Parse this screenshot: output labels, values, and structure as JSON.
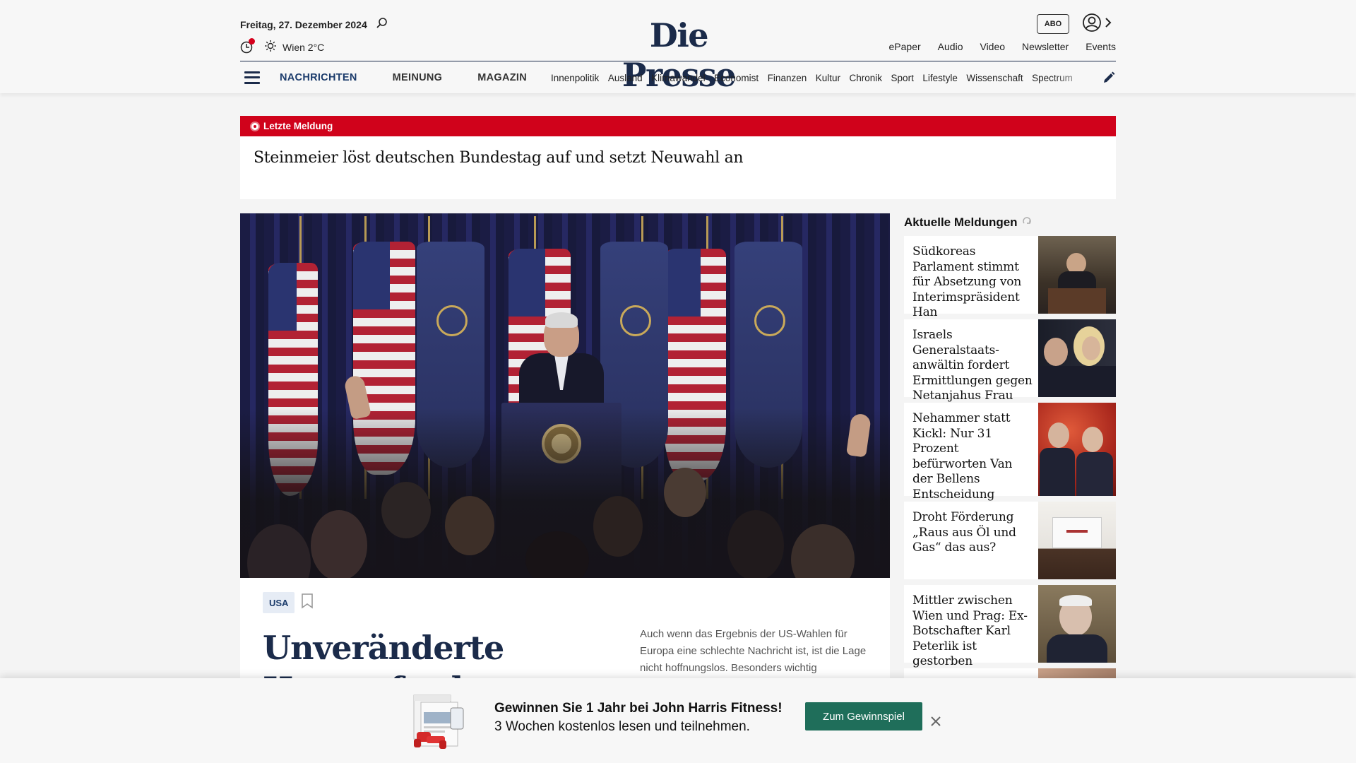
{
  "header": {
    "date": "Freitag, 27. Dezember 2024",
    "weather": "Wien 2°C",
    "logo": "Die Presse",
    "abo_label": "ABO",
    "top_links": [
      "ePaper",
      "Audio",
      "Video",
      "Newsletter",
      "Events"
    ],
    "main_nav": [
      "NACHRICHTEN",
      "MEINUNG",
      "MAGAZIN"
    ],
    "sub_nav": [
      "Innenpolitik",
      "Ausland",
      "Klimawandel",
      "Economist",
      "Finanzen",
      "Kultur",
      "Chronik",
      "Sport",
      "Lifestyle",
      "Wissenschaft",
      "Spectrum"
    ]
  },
  "breaking": {
    "label": "Letzte Meldung",
    "headline": "Steinmeier löst deutschen Bundestag auf und setzt Neuwahl an",
    "color": "#d0021b"
  },
  "lead": {
    "tag": "USA",
    "headline": "Unveränderte Herausforderungen",
    "teaser": "Auch wenn das Ergebnis der US-Wahlen für Europa eine schlechte Nachricht ist, ist die Lage nicht hoffnungslos. Besonders wichtig"
  },
  "aktuelle": {
    "title": "Aktuelle Meldungen",
    "items": [
      {
        "text": "Südkoreas Parlament stimmt für Absetzung von Inte­rimspräsident Han"
      },
      {
        "text": "Israels Generalstaats­anwältin fordert Ermittlungen gegen Netanjahus Frau"
      },
      {
        "text": "Nehammer statt Kickl: Nur 31 Prozent befürworten Van der Bellens Entscheidung"
      },
      {
        "text": "Droht Förderung „Raus aus Öl und Gas“ das aus?"
      },
      {
        "text": "Mittler zwischen Wien und Prag: Ex-Botschafter Karl Peterlik ist gestorben"
      },
      {
        "text": ""
      }
    ]
  },
  "promo": {
    "title": "Gewinnen Sie 1 Jahr bei John Harris Fitness!",
    "subtitle": "3 Wochen kostenlos lesen und teilnehmen.",
    "button": "Zum Gewinnspiel",
    "button_color": "#1f6e5a"
  }
}
